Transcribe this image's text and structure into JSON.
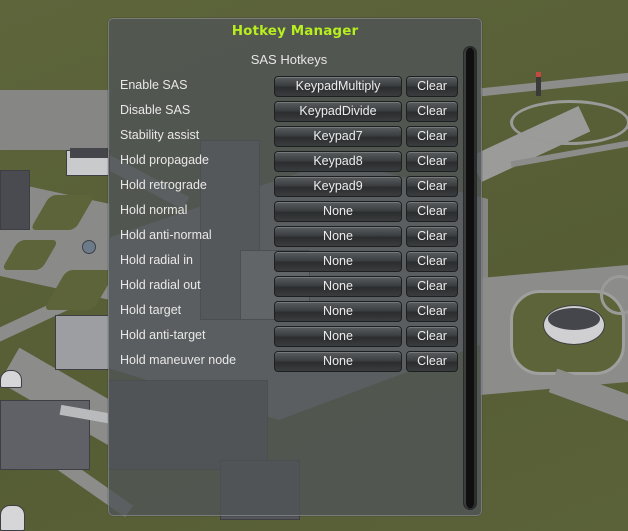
{
  "window": {
    "title": "Hotkey Manager",
    "title_color": "#b7ef1e",
    "section_title": "SAS Hotkeys"
  },
  "hotkeys": [
    {
      "action": "Enable SAS",
      "key": "KeypadMultiply",
      "clear_label": "Clear"
    },
    {
      "action": "Disable SAS",
      "key": "KeypadDivide",
      "clear_label": "Clear"
    },
    {
      "action": "Stability assist",
      "key": "Keypad7",
      "clear_label": "Clear"
    },
    {
      "action": "Hold propagade",
      "key": "Keypad8",
      "clear_label": "Clear"
    },
    {
      "action": "Hold retrograde",
      "key": "Keypad9",
      "clear_label": "Clear"
    },
    {
      "action": "Hold normal",
      "key": "None",
      "clear_label": "Clear"
    },
    {
      "action": "Hold anti-normal",
      "key": "None",
      "clear_label": "Clear"
    },
    {
      "action": "Hold radial in",
      "key": "None",
      "clear_label": "Clear"
    },
    {
      "action": "Hold radial out",
      "key": "None",
      "clear_label": "Clear"
    },
    {
      "action": "Hold target",
      "key": "None",
      "clear_label": "Clear"
    },
    {
      "action": "Hold anti-target",
      "key": "None",
      "clear_label": "Clear"
    },
    {
      "action": "Hold maneuver node",
      "key": "None",
      "clear_label": "Clear"
    }
  ]
}
